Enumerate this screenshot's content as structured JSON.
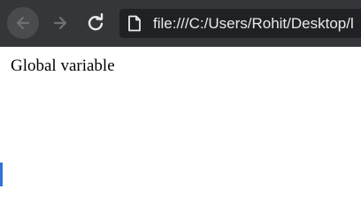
{
  "toolbar": {
    "back_icon": "arrow-left-icon",
    "forward_icon": "arrow-right-icon",
    "reload_icon": "reload-icon",
    "page_icon": "page-icon",
    "url": "file:///C:/Users/Rohit/Desktop/l"
  },
  "page": {
    "text": "Global variable"
  },
  "colors": {
    "toolbar_bg": "#35363a",
    "omnibox_bg": "#202124",
    "url_text": "#e8eaed",
    "page_bg": "#ffffff"
  }
}
